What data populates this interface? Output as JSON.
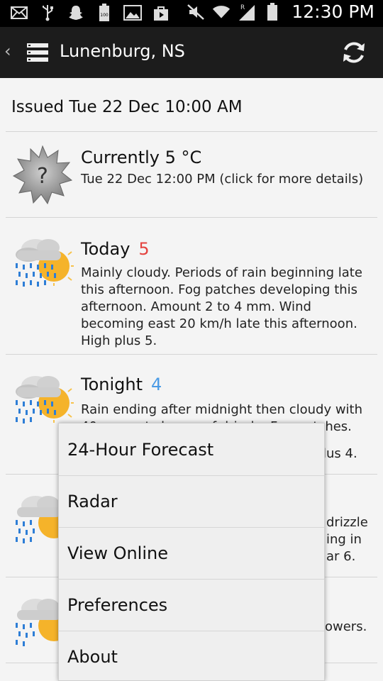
{
  "status_bar": {
    "icons_left": [
      "mail-icon",
      "usb-icon",
      "snapchat-icon",
      "battery-100-icon",
      "gallery-icon",
      "shopping-bag-icon"
    ],
    "icons_right": [
      "mute-icon",
      "wifi-icon",
      "signal-icon",
      "battery-icon"
    ],
    "time": "12:30 PM"
  },
  "action_bar": {
    "title": "Lunenburg, NS"
  },
  "issued": "Issued Tue 22 Dec 10:00 AM",
  "current": {
    "title": "Currently 5 °C",
    "detail": "Tue 22 Dec 12:00 PM (click for more details)"
  },
  "forecasts": [
    {
      "period": "Today",
      "temp": "5",
      "temp_color": "#e4433f",
      "text": "Mainly cloudy. Periods of rain beginning late this afternoon. Fog patches developing this afternoon. Amount 2 to 4 mm. Wind becoming east 20 km/h late this afternoon. High plus 5."
    },
    {
      "period": "Tonight",
      "temp": "4",
      "temp_color": "#4a9be6",
      "text_line1": "Rain ending after midnight then cloudy with",
      "text_line2": "40 percent chance of drizzle. Fog patches.",
      "text_tail": "lus 4."
    },
    {
      "text_tail_1": "drizzle",
      "text_tail_2": "ing in",
      "text_tail_3": "ar 6."
    },
    {
      "text_tail": "owers."
    }
  ],
  "menu": {
    "items": [
      "24-Hour Forecast",
      "Radar",
      "View Online",
      "Preferences",
      "About"
    ]
  }
}
